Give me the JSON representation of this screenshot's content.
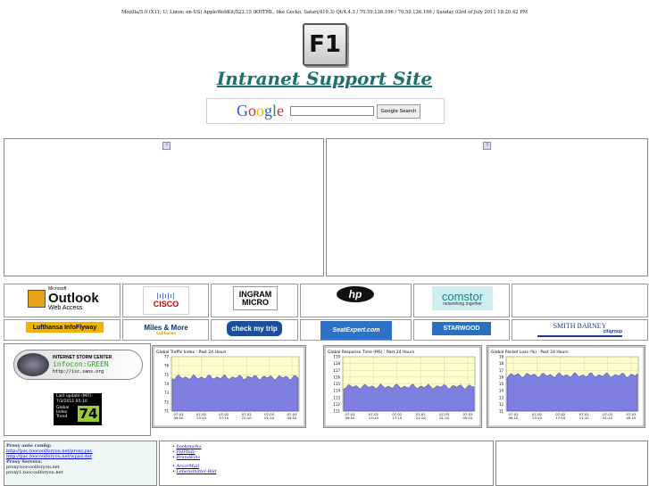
{
  "user_agent": "Mozilla/5.0 (X11; U; Linux; en-US) AppleWebKit/523.15 (KHTML, like Gecko, Safari/419.3) Qt/4.4.3 / 70.59.126.196 / 70.59.126.196 / Sunday 03rd of July 2011 18:20:42 PM",
  "f1_logo": "F1",
  "site_title": "Intranet Support Site",
  "search": {
    "logo": "Google",
    "button": "Google Search",
    "placeholder": ""
  },
  "logos_row1": [
    "Microsoft Outlook Web Access",
    "CISCO",
    "INGRAM MICRO",
    "hp",
    "comstor"
  ],
  "logos_row2": [
    "Lufthansa InfoFlyway",
    "Miles & More",
    "check my trip",
    "SeatExpert.com",
    "STARWOOD",
    "SMITH BARNEY"
  ],
  "logo_text": {
    "outlook_small": "Microsoft",
    "outlook_big": "Outlook",
    "outlook_sub": "Web Access",
    "comstor_sub": "networking together",
    "miles_sub": "Lufthansa",
    "smith_sub": "citigroup"
  },
  "isc": {
    "logo": "INTERNET STORM CENTER",
    "infocon": "infocon:GREEN",
    "url": "http://isc.sans.org",
    "last_update_label": "Last update (MIT):",
    "last_update": "7/3/2011 05:10",
    "index_label": "Global Index Trend",
    "index_value": "74"
  },
  "graphs": [
    {
      "title": "Global Traffic Index : Past 24 Hours",
      "y_ticks": [
        "77",
        "76",
        "75",
        "74",
        "73",
        "72",
        "71"
      ],
      "x_ticks": [
        "07-02 09:10",
        "07-02 13:10",
        "07-02 17:10",
        "07-02 21:10",
        "07-03 01:10",
        "07-03 05:10"
      ]
    },
    {
      "title": "Global Response Time (MS) : Past 24 Hours",
      "y_ticks": [
        "119",
        "118",
        "117",
        "116",
        "115",
        "114",
        "113",
        "112",
        "111"
      ],
      "x_ticks": [
        "07-02 09:10",
        "07-02 13:10",
        "07-02 17:10",
        "07-02 21:10",
        "07-03 01:10",
        "07-03 05:10"
      ]
    },
    {
      "title": "Global Packet Loss (%) : Past 24 Hours",
      "y_ticks": [
        "19",
        "18",
        "17",
        "16",
        "15",
        "14",
        "13",
        "12",
        "11"
      ],
      "x_ticks": [
        "07-02 09:10",
        "07-02 13:10",
        "07-02 17:10",
        "07-02 21:10",
        "07-03 01:10",
        "07-03 05:10"
      ]
    }
  ],
  "proxy": {
    "auto_label": "Proxy auto config:",
    "auto_links": [
      "http://pac.toocoolforyou.net/proxy.pac",
      "http://pac.toocoolforyou.net/wpad.dat"
    ],
    "servers_label": "Proxy Servers:",
    "servers": [
      "proxy.toocoolforyou.net",
      "proxy1.toocoolforyou.net"
    ]
  },
  "links": [
    "bookmarks",
    "PHPInfo",
    "BrandEins",
    "ArcorMail",
    "Lebensmittel-Bild"
  ]
}
